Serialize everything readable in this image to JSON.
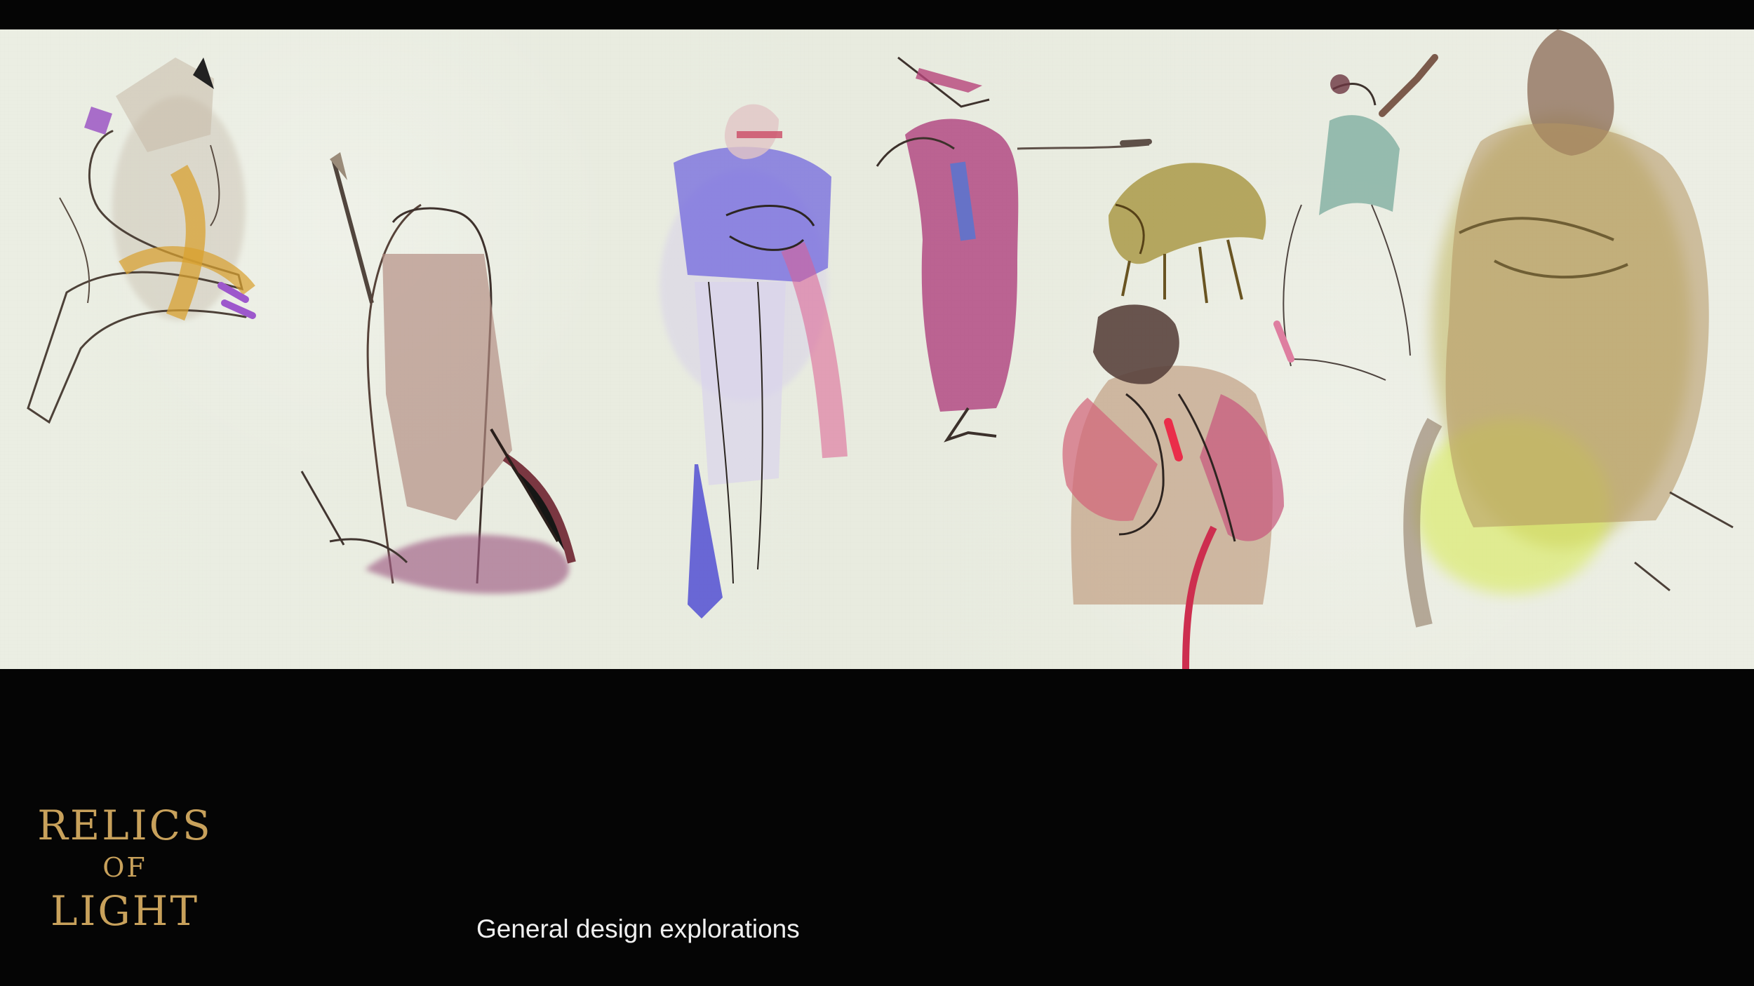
{
  "artwork": {
    "figures": [
      {
        "name": "crowned-figure"
      },
      {
        "name": "armored-swordsman"
      },
      {
        "name": "caped-knight"
      },
      {
        "name": "robed-wanderer"
      },
      {
        "name": "ornate-canopy"
      },
      {
        "name": "pink-tunic-figure"
      },
      {
        "name": "green-dress-dancer"
      },
      {
        "name": "olive-armored-figure"
      }
    ],
    "colors": {
      "paper": "#e9ecdf",
      "ink": "#2b2520",
      "gold": "#c8a15b",
      "violet": "#6a5dd6",
      "magenta": "#b23a74",
      "rose": "#d76d90",
      "olive": "#a48e2a",
      "lime": "#d4e35f",
      "brown": "#8d6a55"
    }
  },
  "logo": {
    "line1": "RELICS",
    "line2": "OF",
    "line3": "LIGHT",
    "color": "#c8a15b"
  },
  "caption": "General design explorations"
}
